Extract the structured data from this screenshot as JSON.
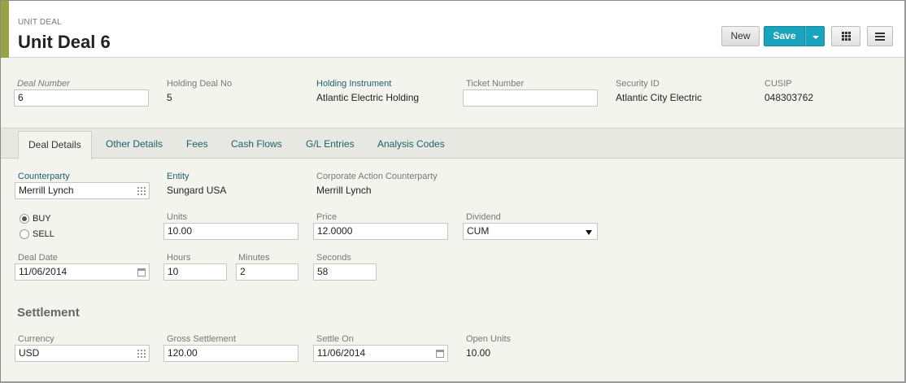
{
  "header": {
    "eyebrow": "UNIT DEAL",
    "title": "Unit Deal 6",
    "new_label": "New",
    "save_label": "Save"
  },
  "summary": {
    "deal_number_label": "Deal Number",
    "deal_number_value": "6",
    "holding_deal_no_label": "Holding Deal No",
    "holding_deal_no_value": "5",
    "holding_instrument_label": "Holding Instrument",
    "holding_instrument_value": "Atlantic Electric Holding",
    "ticket_number_label": "Ticket Number",
    "ticket_number_value": "",
    "security_id_label": "Security ID",
    "security_id_value": "Atlantic City Electric",
    "cusip_label": "CUSIP",
    "cusip_value": "048303762"
  },
  "tabs": [
    {
      "label": "Deal Details",
      "active": true
    },
    {
      "label": "Other Details"
    },
    {
      "label": "Fees"
    },
    {
      "label": "Cash Flows"
    },
    {
      "label": "G/L Entries"
    },
    {
      "label": "Analysis Codes"
    }
  ],
  "details": {
    "counterparty_label": "Counterparty",
    "counterparty_value": "Merrill Lynch",
    "entity_label": "Entity",
    "entity_value": "Sungard USA",
    "ca_counterparty_label": "Corporate Action Counterparty",
    "ca_counterparty_value": "Merrill Lynch",
    "buy_label": "BUY",
    "sell_label": "SELL",
    "side_selected": "BUY",
    "units_label": "Units",
    "units_value": "10.00",
    "price_label": "Price",
    "price_value": "12.0000",
    "dividend_label": "Dividend",
    "dividend_value": "CUM",
    "deal_date_label": "Deal Date",
    "deal_date_value": "11/06/2014",
    "hours_label": "Hours",
    "hours_value": "10",
    "minutes_label": "Minutes",
    "minutes_value": "2",
    "seconds_label": "Seconds",
    "seconds_value": "58"
  },
  "settlement": {
    "title": "Settlement",
    "currency_label": "Currency",
    "currency_value": "USD",
    "gross_label": "Gross Settlement",
    "gross_value": "120.00",
    "settle_on_label": "Settle On",
    "settle_on_value": "11/06/2014",
    "open_units_label": "Open Units",
    "open_units_value": "10.00"
  },
  "colors": {
    "accent": "#98a441",
    "save_button": "#1aa3bd",
    "link": "#1d5f6c"
  },
  "icons": [
    "grid-icon",
    "menu-icon",
    "lookup-icon",
    "calendar-icon",
    "chevron-down-icon"
  ]
}
